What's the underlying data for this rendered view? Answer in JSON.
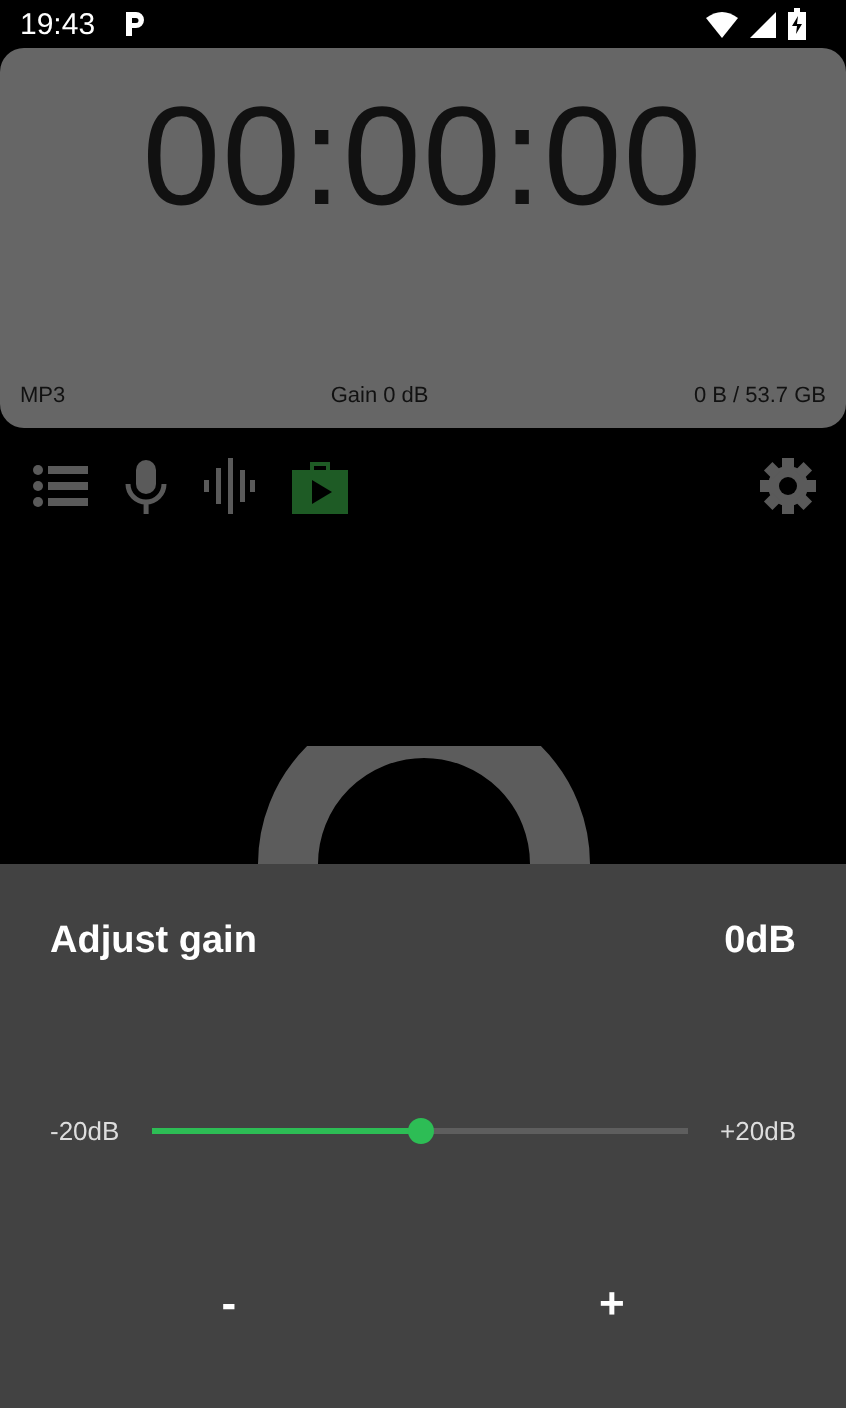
{
  "status_bar": {
    "time": "19:43"
  },
  "timer": {
    "time": "00:00:00",
    "format": "MP3",
    "gain": "Gain 0 dB",
    "storage": "0 B / 53.7 GB"
  },
  "toolbar": [
    {
      "kind": "list",
      "selected": false
    },
    {
      "kind": "mic",
      "selected": false
    },
    {
      "kind": "wave",
      "selected": false
    },
    {
      "kind": "player",
      "selected": true
    }
  ],
  "sheet": {
    "title": "Adjust gain",
    "value": "0dB",
    "min_label": "-20dB",
    "max_label": "+20dB",
    "level": 0.5,
    "buttons": [
      "-",
      "+"
    ]
  }
}
